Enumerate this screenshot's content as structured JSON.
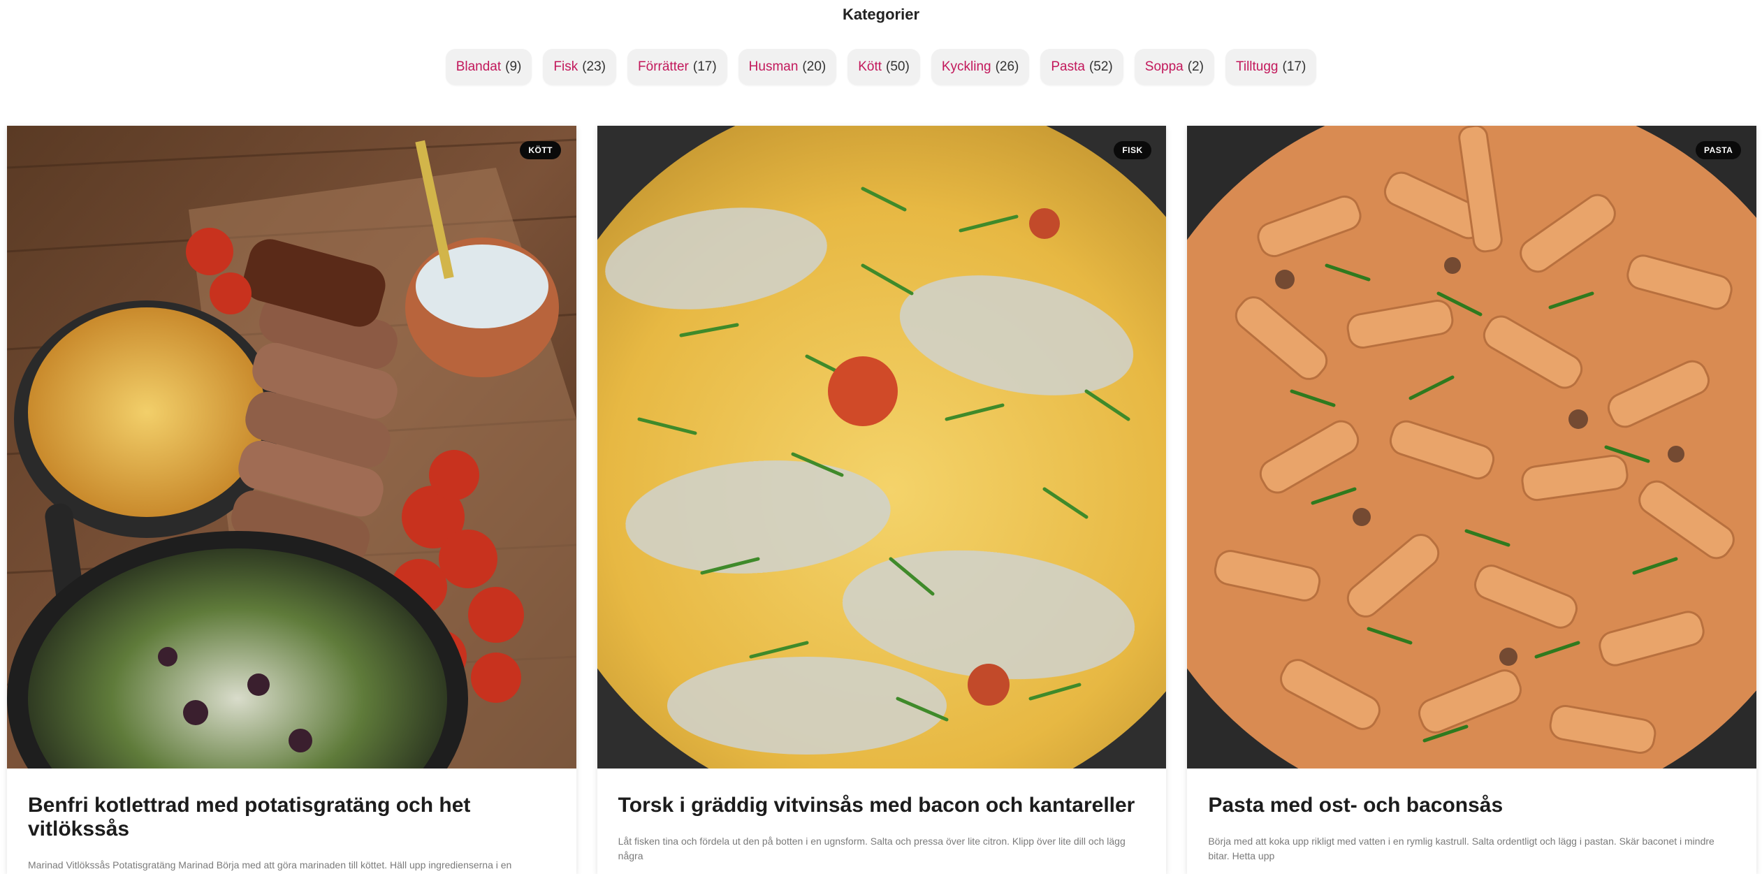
{
  "categories": {
    "title": "Kategorier",
    "items": [
      {
        "name": "Blandat",
        "count": "(9)"
      },
      {
        "name": "Fisk",
        "count": "(23)"
      },
      {
        "name": "Förrätter",
        "count": "(17)"
      },
      {
        "name": "Husman",
        "count": "(20)"
      },
      {
        "name": "Kött",
        "count": "(50)"
      },
      {
        "name": "Kyckling",
        "count": "(26)"
      },
      {
        "name": "Pasta",
        "count": "(52)"
      },
      {
        "name": "Soppa",
        "count": "(2)"
      },
      {
        "name": "Tilltugg",
        "count": "(17)"
      }
    ]
  },
  "recipes": [
    {
      "badge": "KÖTT",
      "title": "Benfri kotlettrad med potatisgratäng och het vitlökssås",
      "excerpt": "Marinad  Vitlökssås Potatisgratäng  Marinad Börja med att göra marinaden till köttet. Häll upp ingredienserna i en",
      "image": "grilled-pork-platter-photo"
    },
    {
      "badge": "FISK",
      "title": "Torsk i gräddig vitvinsås med bacon och kantareller",
      "excerpt": "Låt fisken tina och fördela ut den på botten i en ugnsform. Salta och pressa över lite citron. Klipp över lite dill och lägg några",
      "image": "creamy-cod-dish-photo"
    },
    {
      "badge": "PASTA",
      "title": "Pasta med ost- och baconsås",
      "excerpt": "Börja med att koka upp rikligt med vatten i en rymlig kastrull. Salta ordentligt och lägg i pastan.  Skär baconet i mindre bitar. Hetta upp",
      "image": "rigatoni-pan-photo"
    }
  ],
  "colors": {
    "accent": "#c2185b",
    "badge_bg": "#0a0a0a",
    "pill_bg": "#f1f1f1"
  }
}
